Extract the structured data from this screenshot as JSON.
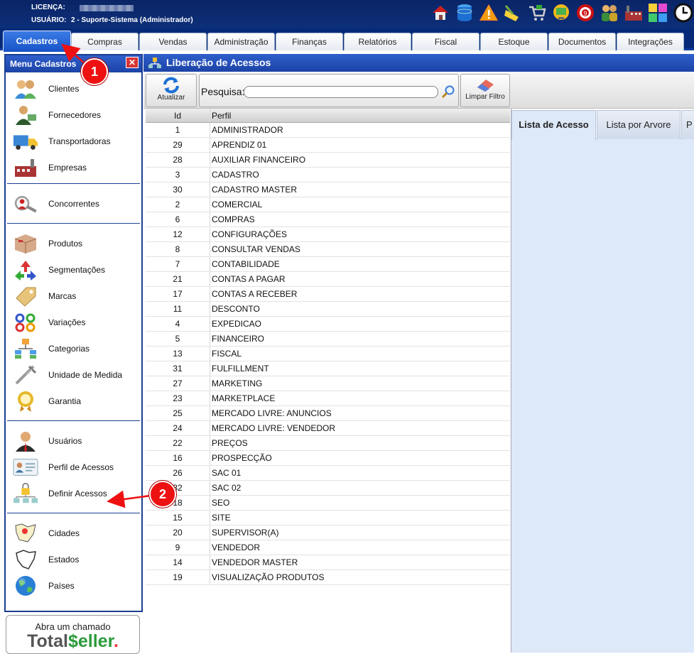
{
  "header": {
    "license_label": "LICENÇA:",
    "user_label": "USUÁRIO:",
    "user_value": "2 - Suporte-Sistema (Administrador)"
  },
  "top_icons": [
    "house-icon",
    "database-icon",
    "warning-icon",
    "broom-icon",
    "cart-icon",
    "monitor-icon",
    "target-icon",
    "people-icon",
    "factory-icon",
    "colors-icon",
    "clock-icon"
  ],
  "tabs": [
    "Cadastros",
    "Compras",
    "Vendas",
    "Administração",
    "Finanças",
    "Relatórios",
    "Fiscal",
    "Estoque",
    "Documentos",
    "Integrações"
  ],
  "sidebar": {
    "title": "Menu Cadastros",
    "close": "✕",
    "sections": [
      [
        {
          "label": "Clientes",
          "icon": "clients-icon"
        },
        {
          "label": "Fornecedores",
          "icon": "supplier-icon"
        },
        {
          "label": "Transportadoras",
          "icon": "truck-icon"
        },
        {
          "label": "Empresas",
          "icon": "factory-icon"
        }
      ],
      [
        {
          "label": "Concorrentes",
          "icon": "magnifier-person-icon"
        }
      ],
      [
        {
          "label": "Produtos",
          "icon": "box-icon"
        },
        {
          "label": "Segmentações",
          "icon": "arrows-icon"
        },
        {
          "label": "Marcas",
          "icon": "tag-icon"
        },
        {
          "label": "Variações",
          "icon": "variations-icon"
        },
        {
          "label": "Categorias",
          "icon": "categories-icon"
        },
        {
          "label": "Unidade de Medida",
          "icon": "caliper-icon"
        },
        {
          "label": "Garantia",
          "icon": "seal-icon"
        }
      ],
      [
        {
          "label": "Usuários",
          "icon": "user-icon"
        },
        {
          "label": "Perfil de Acessos",
          "icon": "id-card-icon"
        },
        {
          "label": "Definir Acessos",
          "icon": "network-lock-icon"
        }
      ],
      [
        {
          "label": "Cidades",
          "icon": "city-map-icon"
        },
        {
          "label": "Estados",
          "icon": "state-map-icon"
        },
        {
          "label": "Países",
          "icon": "globe-icon"
        }
      ]
    ]
  },
  "support": {
    "line1": "Abra um chamado",
    "brand_part1": "Total",
    "brand_part2": "$eller",
    "brand_dot": "."
  },
  "main": {
    "title": "Liberação de Acessos"
  },
  "toolbar": {
    "refresh_label": "Atualizar",
    "search_label": "Pesquisa:",
    "search_value": "",
    "clear_label": "Limpar Filtro"
  },
  "grid": {
    "headers": [
      "Id",
      "Perfil"
    ],
    "rows": [
      [
        "1",
        "ADMINISTRADOR"
      ],
      [
        "29",
        "APRENDIZ 01"
      ],
      [
        "28",
        "AUXILIAR FINANCEIRO"
      ],
      [
        "3",
        "CADASTRO"
      ],
      [
        "30",
        "CADASTRO MASTER"
      ],
      [
        "2",
        "COMERCIAL"
      ],
      [
        "6",
        "COMPRAS"
      ],
      [
        "12",
        "CONFIGURAÇÕES"
      ],
      [
        "8",
        "CONSULTAR VENDAS"
      ],
      [
        "7",
        "CONTABILIDADE"
      ],
      [
        "21",
        "CONTAS A PAGAR"
      ],
      [
        "17",
        "CONTAS A RECEBER"
      ],
      [
        "11",
        "DESCONTO"
      ],
      [
        "4",
        "EXPEDICAO"
      ],
      [
        "5",
        "FINANCEIRO"
      ],
      [
        "13",
        "FISCAL"
      ],
      [
        "31",
        "FULFILLMENT"
      ],
      [
        "27",
        "MARKETING"
      ],
      [
        "23",
        "MARKETPLACE"
      ],
      [
        "25",
        "MERCADO LIVRE: ANUNCIOS"
      ],
      [
        "24",
        "MERCADO LIVRE: VENDEDOR"
      ],
      [
        "22",
        "PREÇOS"
      ],
      [
        "16",
        "PROSPECÇÃO"
      ],
      [
        "26",
        "SAC 01"
      ],
      [
        "32",
        "SAC 02"
      ],
      [
        "18",
        "SEO"
      ],
      [
        "15",
        "SITE"
      ],
      [
        "20",
        "SUPERVISOR(A)"
      ],
      [
        "9",
        "VENDEDOR"
      ],
      [
        "14",
        "VENDEDOR MASTER"
      ],
      [
        "19",
        "VISUALIZAÇÃO PRODUTOS"
      ]
    ]
  },
  "right_tabs": [
    "Lista de Acesso",
    "Lista por Arvore",
    "P"
  ],
  "callouts": [
    "1",
    "2"
  ],
  "colors": {
    "header_bg": "#0a2566",
    "active_tab": "#1652c7",
    "panel_bg": "#dde8f8",
    "callout": "#e11111"
  }
}
